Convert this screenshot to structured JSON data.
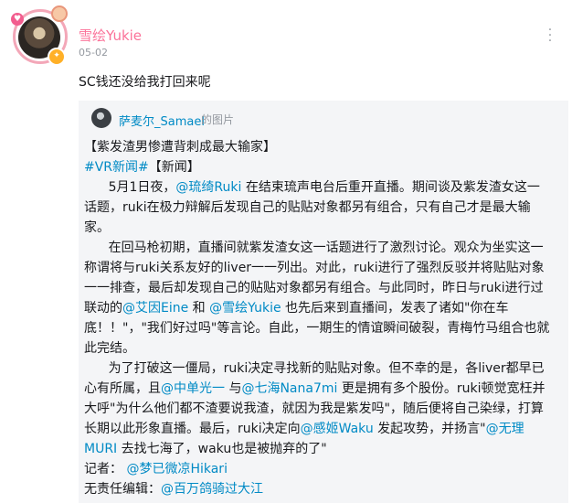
{
  "user": {
    "name": "雪绘Yukie",
    "date": "05-02"
  },
  "post": {
    "text": "SC钱还没给我打回来呢"
  },
  "repost": {
    "author": "萨麦尔_Samael",
    "type_label": "的图片",
    "title": "【紫发渣男惨遭背刺成最大输家】",
    "tag": "#VR新闻#",
    "tag_suffix": "【新闻】",
    "p1": {
      "a": "5月1日夜，",
      "m1": "@琉绮Ruki",
      "b": " 在结束琉声电台后重开直播。期间谈及紫发渣女这一话题，ruki在极力辩解后发现自己的贴贴对象都另有组合，只有自己才是最大输家。"
    },
    "p2": {
      "a": "在回马枪初期，直播间就紫发渣女这一话题进行了激烈讨论。观众为坐实这一称谓将与ruki关系友好的liver一一列出。对此，ruki进行了强烈反驳并将贴贴对象一一排查，最后却发现自己的贴贴对象都另有组合。与此同时，昨日与ruki进行过联动的",
      "m1": "@艾因Eine",
      "b": " 和 ",
      "m2": "@雪绘Yukie",
      "c": " 也先后来到直播间，发表了诸如\"你在车底！！\"，\"我们好过吗\"等言论。自此，一期生的情谊瞬间破裂，青梅竹马组合也就此完结。"
    },
    "p3": {
      "a": "为了打破这一僵局，ruki决定寻找新的贴贴对象。但不幸的是，各liver都早已心有所属，且",
      "m1": "@中单光一",
      "b": " 与",
      "m2": "@七海Nana7mi",
      "c": " 更是拥有多个股份。ruki顿觉宽枉并大呼\"为什么他们都不渣要说我渣，就因为我是紫发吗\"，随后便将自己染绿，打算长期以此形象直播。最后，ruki决定向",
      "m3": "@感姬Waku",
      "d": " 发起攻势，并扬言\"",
      "m4": "@无理MURI",
      "e": " 去找七海了，waku也是被抛弃的了\""
    },
    "reporter_label": "记者：",
    "reporter": "@梦已微凉Hikari",
    "editor_label": "无责任编辑：",
    "editor": "@百万鸽骑过大江"
  }
}
